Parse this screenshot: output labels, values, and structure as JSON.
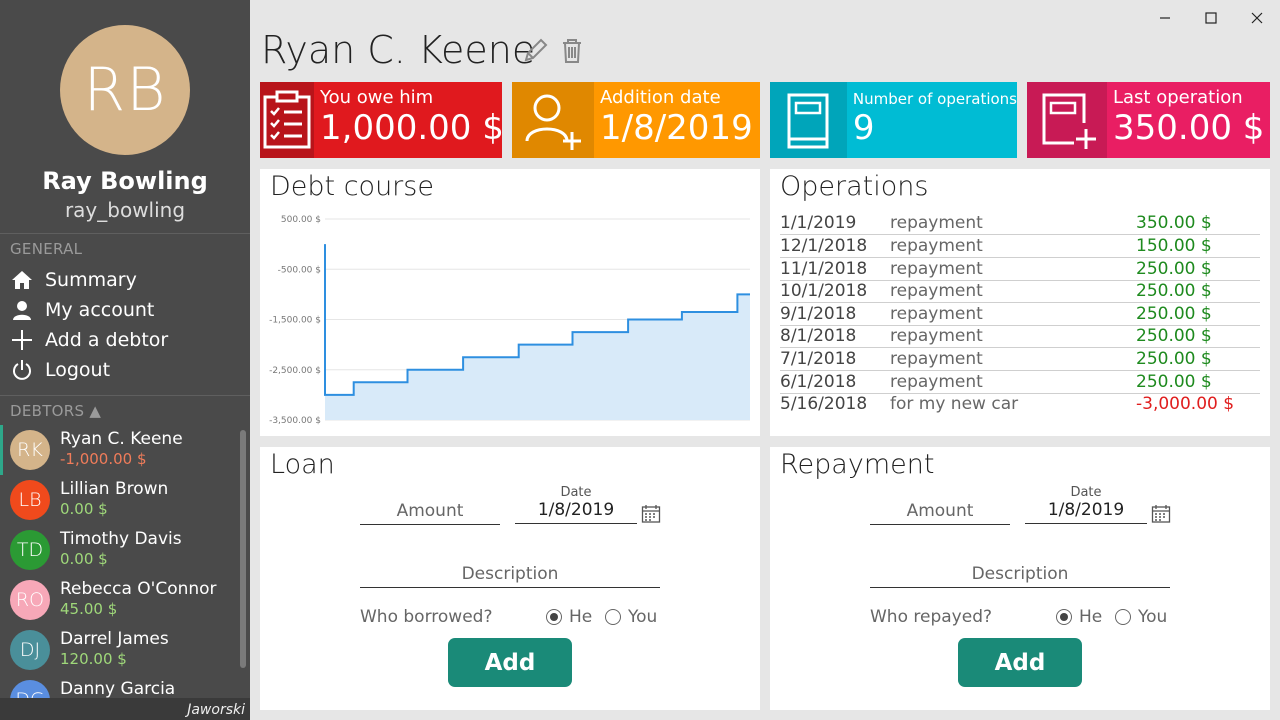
{
  "window": {
    "minimize": "minimize",
    "maximize": "maximize",
    "close": "close"
  },
  "profile": {
    "initials": "RB",
    "name": "Ray Bowling",
    "username": "ray_bowling",
    "avatar_color": "#d4b48a"
  },
  "nav": {
    "section_label": "GENERAL",
    "items": [
      {
        "label": "Summary",
        "icon": "home-icon"
      },
      {
        "label": "My account",
        "icon": "user-icon"
      },
      {
        "label": "Add a debtor",
        "icon": "plus-icon"
      },
      {
        "label": "Logout",
        "icon": "power-icon"
      }
    ]
  },
  "debtors": {
    "section_label": "DEBTORS ▲",
    "items": [
      {
        "initials": "RK",
        "name": "Ryan C. Keene",
        "amount": "-1,000.00 $",
        "color": "#d4b48a",
        "amount_color": "#f07c5a"
      },
      {
        "initials": "LB",
        "name": "Lillian Brown",
        "amount": "0.00 $",
        "color": "#f04a1c",
        "amount_color": "#9fd87a"
      },
      {
        "initials": "TD",
        "name": "Timothy Davis",
        "amount": "0.00 $",
        "color": "#2b9a34",
        "amount_color": "#9fd87a"
      },
      {
        "initials": "RO",
        "name": "Rebecca O'Connor",
        "amount": "45.00 $",
        "color": "#f7a8b8",
        "amount_color": "#9fd87a"
      },
      {
        "initials": "DJ",
        "name": "Darrel James",
        "amount": "120.00 $",
        "color": "#4a8f9a",
        "amount_color": "#9fd87a"
      },
      {
        "initials": "DG",
        "name": "Danny Garcia",
        "amount": "",
        "color": "#5a8ee0",
        "amount_color": "#9fd87a"
      }
    ]
  },
  "brand": "Jaworski",
  "header": {
    "title": "Ryan C. Keene",
    "edit_icon": "pencil-icon",
    "delete_icon": "trash-icon"
  },
  "tiles": [
    {
      "label": "You owe him",
      "value": "1,000.00 $",
      "color": "#e0191e",
      "icon_bg": "#b8141a",
      "icon": "clipboard-list-icon"
    },
    {
      "label": "Addition date",
      "value": "1/8/2019",
      "color": "#ff9800",
      "icon_bg": "#e08800",
      "icon": "add-user-icon"
    },
    {
      "label": "Number of operations",
      "value": "9",
      "color": "#00bcd4",
      "icon_bg": "#00a5ba",
      "icon": "book-icon"
    },
    {
      "label": "Last operation",
      "value": "350.00 $",
      "color": "#e91e63",
      "icon_bg": "#c81a55",
      "icon": "add-card-icon"
    }
  ],
  "debt_course": {
    "title": "Debt course"
  },
  "chart_data": {
    "type": "area",
    "title": "Debt course",
    "y_ticks": [
      "500.00 $",
      "-500.00 $",
      "-1,500.00 $",
      "-2,500.00 $",
      "-3,500.00 $"
    ],
    "ylim": [
      -3500,
      500
    ],
    "x": [
      "5/16/2018",
      "6/1/2018",
      "7/1/2018",
      "8/1/2018",
      "9/1/2018",
      "10/1/2018",
      "11/1/2018",
      "12/1/2018",
      "1/1/2019",
      "1/8/2019"
    ],
    "values": [
      -3000,
      -2750,
      -2500,
      -2250,
      -2000,
      -1750,
      -1500,
      -1350,
      -1000,
      -1000
    ],
    "start_value": 0,
    "line_color": "#2e8fe0",
    "fill_color": "#d8eaf9",
    "grid": true
  },
  "operations": {
    "title": "Operations",
    "rows": [
      {
        "date": "1/1/2019",
        "type": "repayment",
        "amount": "350.00 $",
        "color": "#1e8a1e"
      },
      {
        "date": "12/1/2018",
        "type": "repayment",
        "amount": "150.00 $",
        "color": "#1e8a1e"
      },
      {
        "date": "11/1/2018",
        "type": "repayment",
        "amount": "250.00 $",
        "color": "#1e8a1e"
      },
      {
        "date": "10/1/2018",
        "type": "repayment",
        "amount": "250.00 $",
        "color": "#1e8a1e"
      },
      {
        "date": "9/1/2018",
        "type": "repayment",
        "amount": "250.00 $",
        "color": "#1e8a1e"
      },
      {
        "date": "8/1/2018",
        "type": "repayment",
        "amount": "250.00 $",
        "color": "#1e8a1e"
      },
      {
        "date": "7/1/2018",
        "type": "repayment",
        "amount": "250.00 $",
        "color": "#1e8a1e"
      },
      {
        "date": "6/1/2018",
        "type": "repayment",
        "amount": "250.00 $",
        "color": "#1e8a1e"
      },
      {
        "date": "5/16/2018",
        "type": "for my new car",
        "amount": "-3,000.00 $",
        "color": "#e01e1e"
      }
    ]
  },
  "loan": {
    "title": "Loan",
    "amount_placeholder": "Amount",
    "date_label": "Date",
    "date_value": "1/8/2019",
    "description_placeholder": "Description",
    "question": "Who borrowed?",
    "option_he": "He",
    "option_you": "You",
    "selected": "he",
    "button": "Add"
  },
  "repayment": {
    "title": "Repayment",
    "amount_placeholder": "Amount",
    "date_label": "Date",
    "date_value": "1/8/2019",
    "description_placeholder": "Description",
    "question": "Who repayed?",
    "option_he": "He",
    "option_you": "You",
    "selected": "he",
    "button": "Add"
  }
}
